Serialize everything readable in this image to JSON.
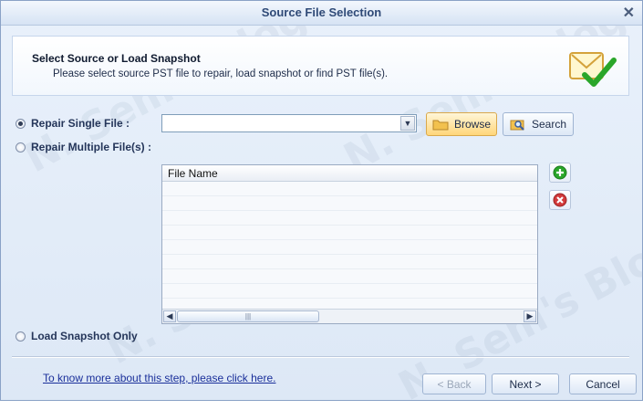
{
  "window": {
    "title": "Source File Selection",
    "close_glyph": "✕"
  },
  "header": {
    "title": "Select Source or Load Snapshot",
    "subtitle": "Please select source PST file to repair, load snapshot or find PST file(s).",
    "icon": "mail-check-icon"
  },
  "options": {
    "repair_single": {
      "label": "Repair Single File :",
      "selected": true
    },
    "repair_multiple": {
      "label": "Repair Multiple File(s) :",
      "selected": false
    },
    "load_snapshot": {
      "label": "Load Snapshot Only",
      "selected": false
    }
  },
  "file_combo": {
    "value": ""
  },
  "buttons": {
    "browse": "Browse",
    "search": "Search",
    "back": "< Back",
    "next": "Next >",
    "cancel": "Cancel"
  },
  "file_list": {
    "column_header": "File Name",
    "rows": [],
    "scroll_thumb_grip": "|||"
  },
  "help_link": "To know more about this step, please click here.",
  "watermark": "N. Sem's Blog",
  "colors": {
    "accent": "#2f4a77",
    "browse_bg": "#ffd67a",
    "add": "#2aa62a",
    "remove": "#d23a3a"
  }
}
